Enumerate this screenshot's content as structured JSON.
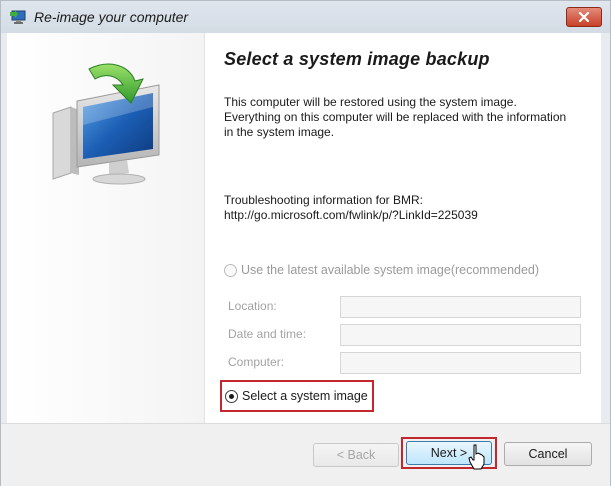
{
  "window": {
    "title": "Re-image your computer",
    "icons": {
      "app": "monitor-restore-icon",
      "close": "close-icon",
      "hero": "computer-restore-arrow-icon"
    }
  },
  "main": {
    "heading": "Select a system image backup",
    "description": "This computer will be restored using the system image. Everything on this computer will be replaced with the information in the system image.",
    "troubleshooting_label": "Troubleshooting information for BMR:",
    "troubleshooting_url": "http://go.microsoft.com/fwlink/p/?LinkId=225039",
    "option_latest": "Use the latest available system image(recommended)",
    "fields": {
      "location_label": "Location:",
      "date_label": "Date and time:",
      "computer_label": "Computer:"
    },
    "option_select": "Select a system image",
    "selected_option": "Select a system image"
  },
  "buttons": {
    "back": "< Back",
    "next": "Next >",
    "cancel": "Cancel"
  },
  "colors": {
    "highlight": "#c1272d",
    "close_button": "#c7412a"
  }
}
